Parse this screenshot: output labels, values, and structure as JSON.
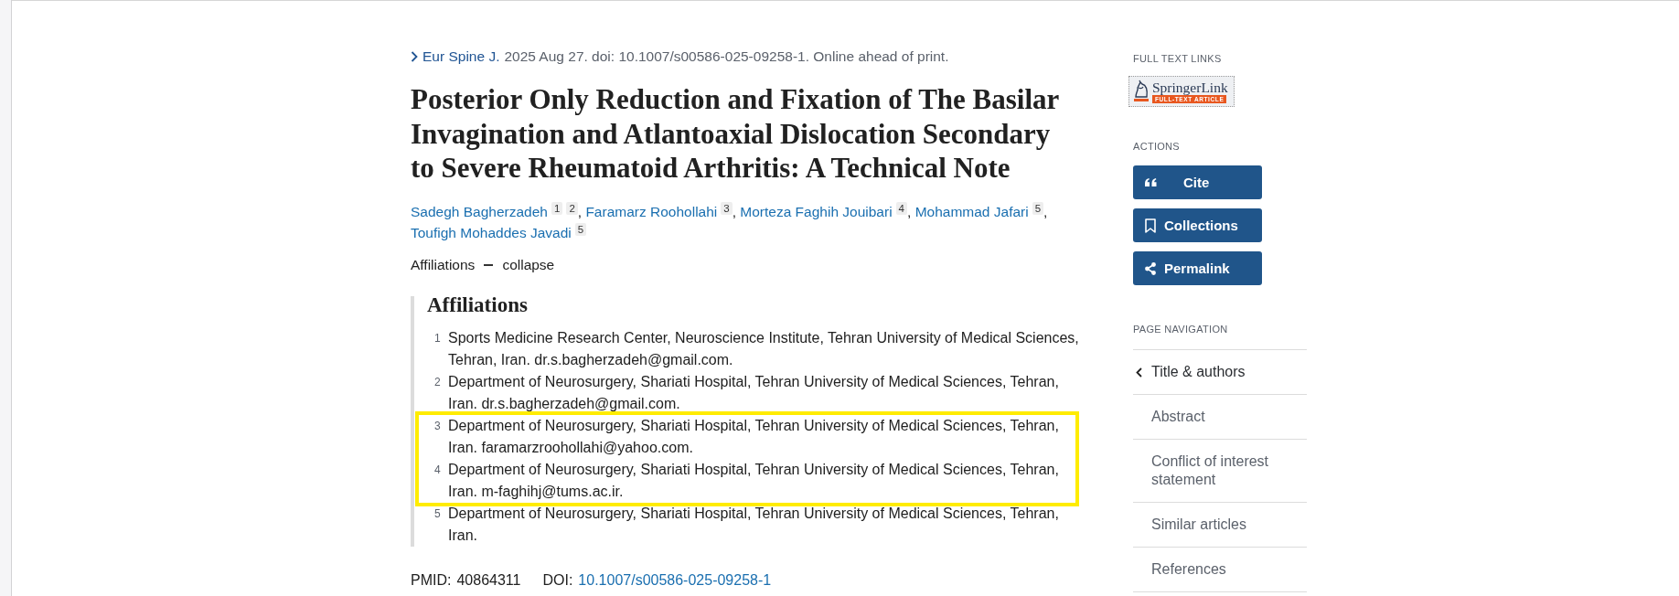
{
  "citation": {
    "journal": "Eur Spine J.",
    "details": "2025 Aug 27. doi: 10.1007/s00586-025-09258-1. Online ahead of print."
  },
  "title": "Posterior Only Reduction and Fixation of The Basilar Invagination and Atlantoaxial Dislocation Secondary to Severe Rheumatoid Arthritis: A Technical Note",
  "authors": [
    {
      "name": "Sadegh Bagherzadeh",
      "refs": [
        "1",
        "2"
      ],
      "separator": ","
    },
    {
      "name": "Faramarz Roohollahi",
      "refs": [
        "3"
      ],
      "separator": ","
    },
    {
      "name": "Morteza Faghih Jouibari",
      "refs": [
        "4"
      ],
      "separator": ","
    },
    {
      "name": "Mohammad Jafari",
      "refs": [
        "5"
      ],
      "separator": ","
    },
    {
      "name": "Toufigh Mohaddes Javadi",
      "refs": [
        "5"
      ]
    }
  ],
  "affiliations_toggle": {
    "label": "Affiliations",
    "action": "collapse",
    "expanded": true
  },
  "affiliations": {
    "heading": "Affiliations",
    "items": [
      {
        "number": "1",
        "text": "Sports Medicine Research Center, Neuroscience Institute, Tehran University of Medical Sciences, Tehran, Iran. dr.s.bagherzadeh@gmail.com.",
        "highlighted": false
      },
      {
        "number": "2",
        "text": "Department of Neurosurgery, Shariati Hospital, Tehran University of Medical Sciences, Tehran, Iran. dr.s.bagherzadeh@gmail.com.",
        "highlighted": false
      },
      {
        "number": "3",
        "text": "Department of Neurosurgery, Shariati Hospital, Tehran University of Medical Sciences, Tehran, Iran. faramarzroohollahi@yahoo.com.",
        "highlighted": true
      },
      {
        "number": "4",
        "text": "Department of Neurosurgery, Shariati Hospital, Tehran University of Medical Sciences, Tehran, Iran. m-faghihj@tums.ac.ir.",
        "highlighted": true
      },
      {
        "number": "5",
        "text": "Department of Neurosurgery, Shariati Hospital, Tehran University of Medical Sciences, Tehran, Iran.",
        "highlighted": false
      }
    ]
  },
  "identifiers": [
    {
      "label": "PMID:",
      "value": "40864311",
      "kind": "text"
    },
    {
      "label": "DOI:",
      "value": "10.1007/s00586-025-09258-1",
      "kind": "link"
    }
  ],
  "sidebar": {
    "full_text_links": {
      "heading": "FULL TEXT LINKS",
      "links": [
        {
          "name": "SpringerLink",
          "tag": "FULL-TEXT ARTICLE"
        }
      ]
    },
    "actions": {
      "heading": "ACTIONS",
      "buttons": [
        {
          "label": "Cite",
          "kind": "cite"
        },
        {
          "label": "Collections",
          "kind": "collections"
        },
        {
          "label": "Permalink",
          "kind": "permalink"
        }
      ]
    },
    "page_navigation": {
      "heading": "PAGE NAVIGATION",
      "items": [
        {
          "label": "Title & authors",
          "selected": true
        },
        {
          "label": "Abstract",
          "selected": false
        },
        {
          "label": "Conflict of interest statement",
          "selected": false
        },
        {
          "label": "Similar articles",
          "selected": false
        },
        {
          "label": "References",
          "selected": false
        }
      ]
    }
  }
}
